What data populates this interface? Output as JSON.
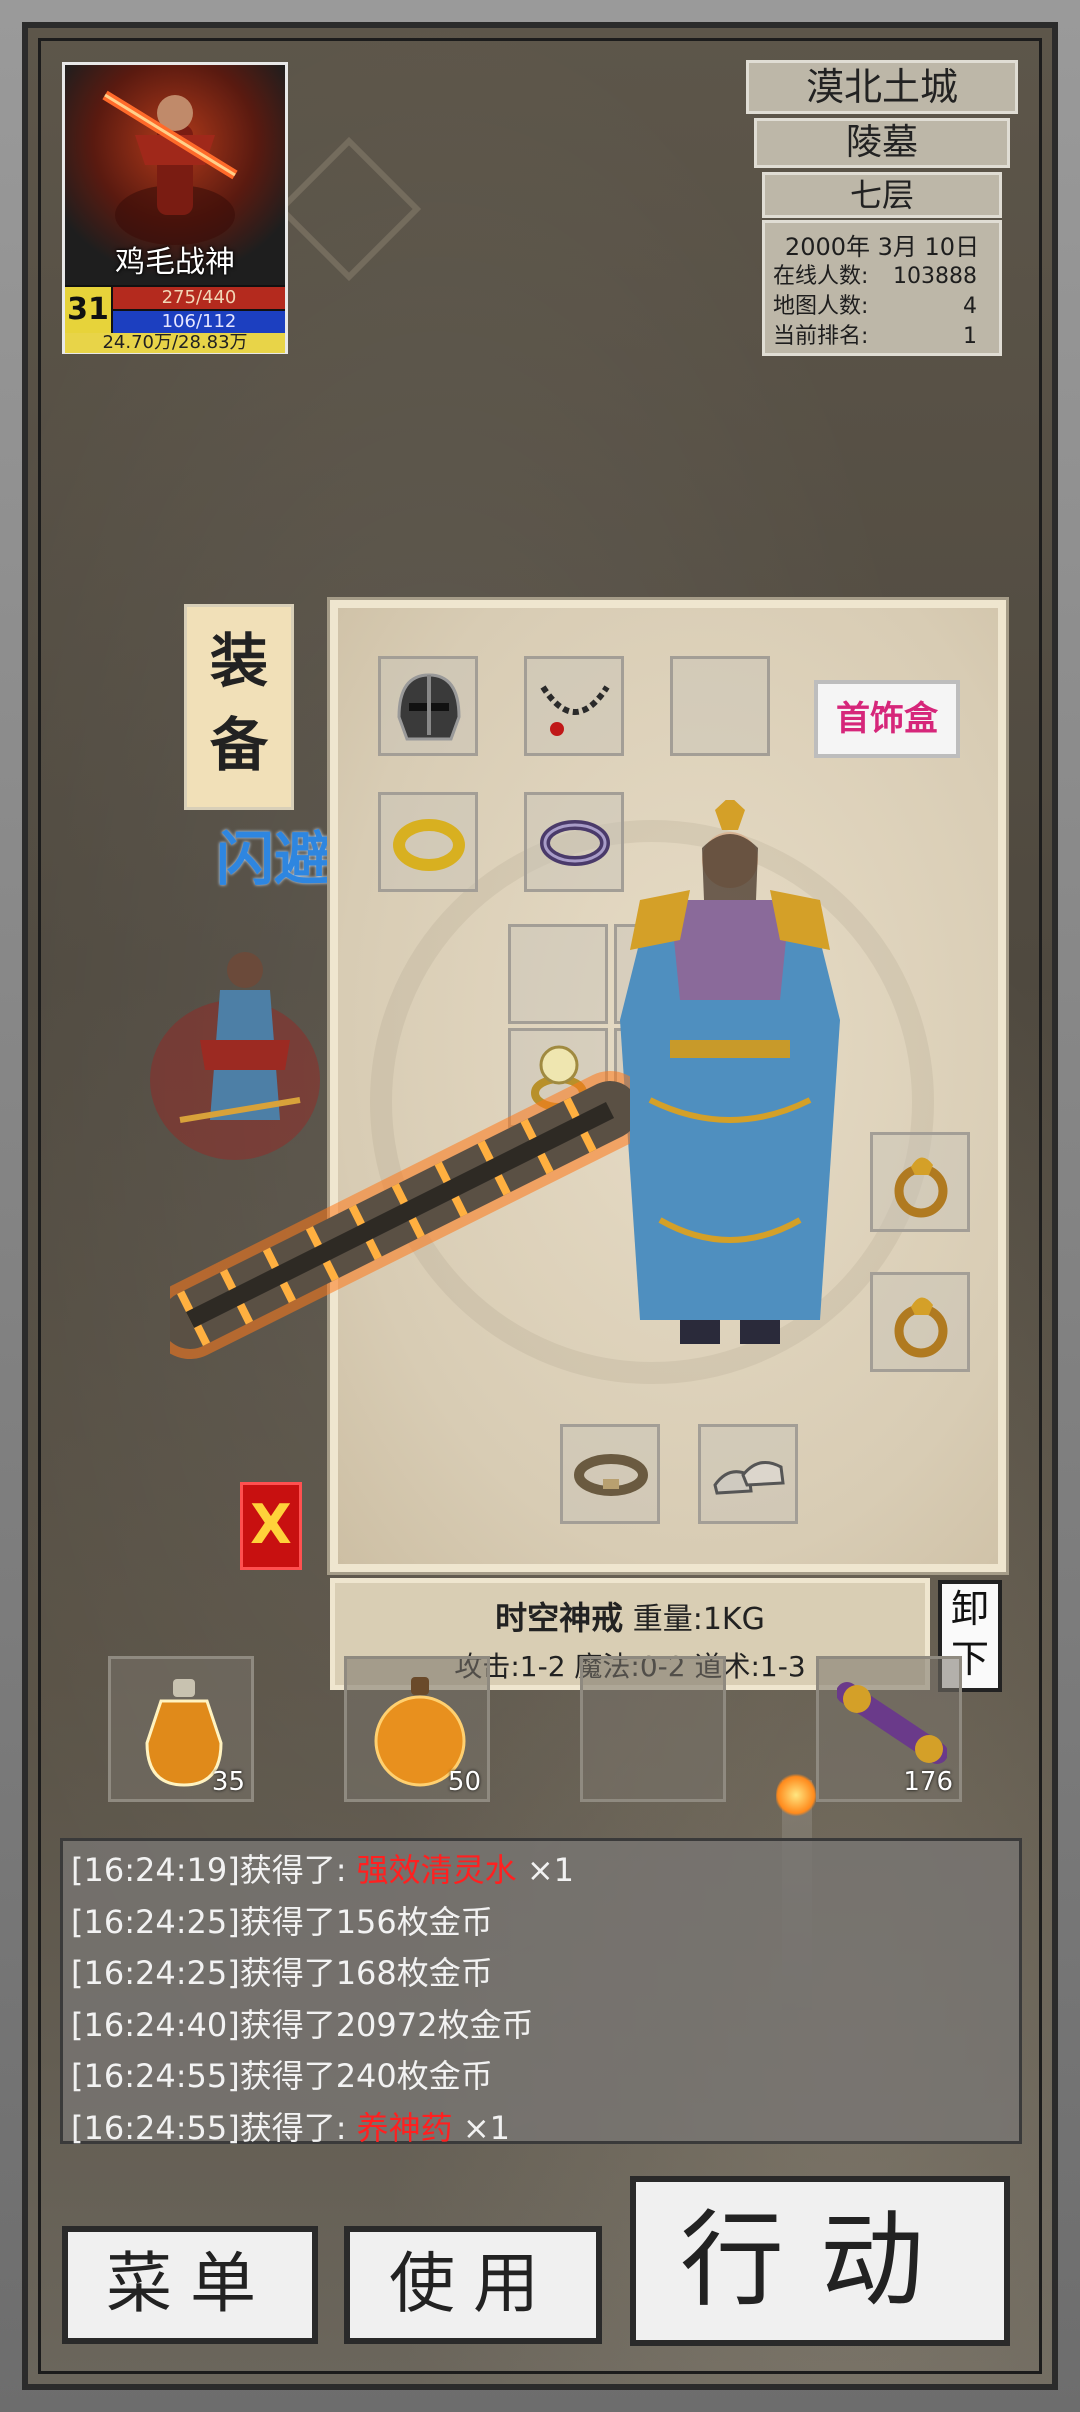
{
  "player": {
    "name": "鸡毛战神",
    "level": "31",
    "hp": "275/440",
    "mp": "106/112",
    "exp": "24.70万/28.83万",
    "hp_fraction": 0.625,
    "mp_fraction": 0.946
  },
  "location": {
    "region": "漠北土城",
    "area": "陵墓",
    "floor": "七层",
    "date": "2000年 3月 10日",
    "online_label": "在线人数:",
    "online_value": "103888",
    "map_label": "地图人数:",
    "map_value": "4",
    "rank_label": "当前排名:",
    "rank_value": "1"
  },
  "equipment": {
    "tab_label_1": "装",
    "tab_label_2": "备",
    "jewelry_box_label": "首饰盒",
    "floating_text": "闪避",
    "close_label": "X"
  },
  "item_info": {
    "name": "时空神戒",
    "weight": "重量:1KG",
    "stats": "攻击:1-2 魔法:0-2 道术:1-3",
    "unequip_label_1": "卸",
    "unequip_label_2": "下"
  },
  "quick_slots": [
    {
      "icon": "potion-bottle-icon",
      "count": "35"
    },
    {
      "icon": "potion-flask-icon",
      "count": "50"
    },
    {
      "icon": "empty",
      "count": ""
    },
    {
      "icon": "scroll-icon",
      "count": "176"
    }
  ],
  "log": [
    {
      "time": "[16:24:19]",
      "text": "获得了: ",
      "item": "强效清灵水",
      "suffix": " ×1"
    },
    {
      "time": "[16:24:25]",
      "text": "获得了156枚金币",
      "item": "",
      "suffix": ""
    },
    {
      "time": "[16:24:25]",
      "text": "获得了168枚金币",
      "item": "",
      "suffix": ""
    },
    {
      "time": "[16:24:40]",
      "text": "获得了20972枚金币",
      "item": "",
      "suffix": ""
    },
    {
      "time": "[16:24:55]",
      "text": "获得了240枚金币",
      "item": "",
      "suffix": ""
    },
    {
      "time": "[16:24:55]",
      "text": "获得了: ",
      "item": "养神药",
      "suffix": " ×1"
    }
  ],
  "buttons": {
    "menu": "菜单",
    "use": "使用",
    "action": "行动"
  },
  "colors": {
    "item_highlight": "#ff2020",
    "jewelry_box_text": "#d6267a",
    "hp_bar": "#b42a1e",
    "mp_bar": "#1c3fc0",
    "exp_bar": "#e8d448"
  }
}
